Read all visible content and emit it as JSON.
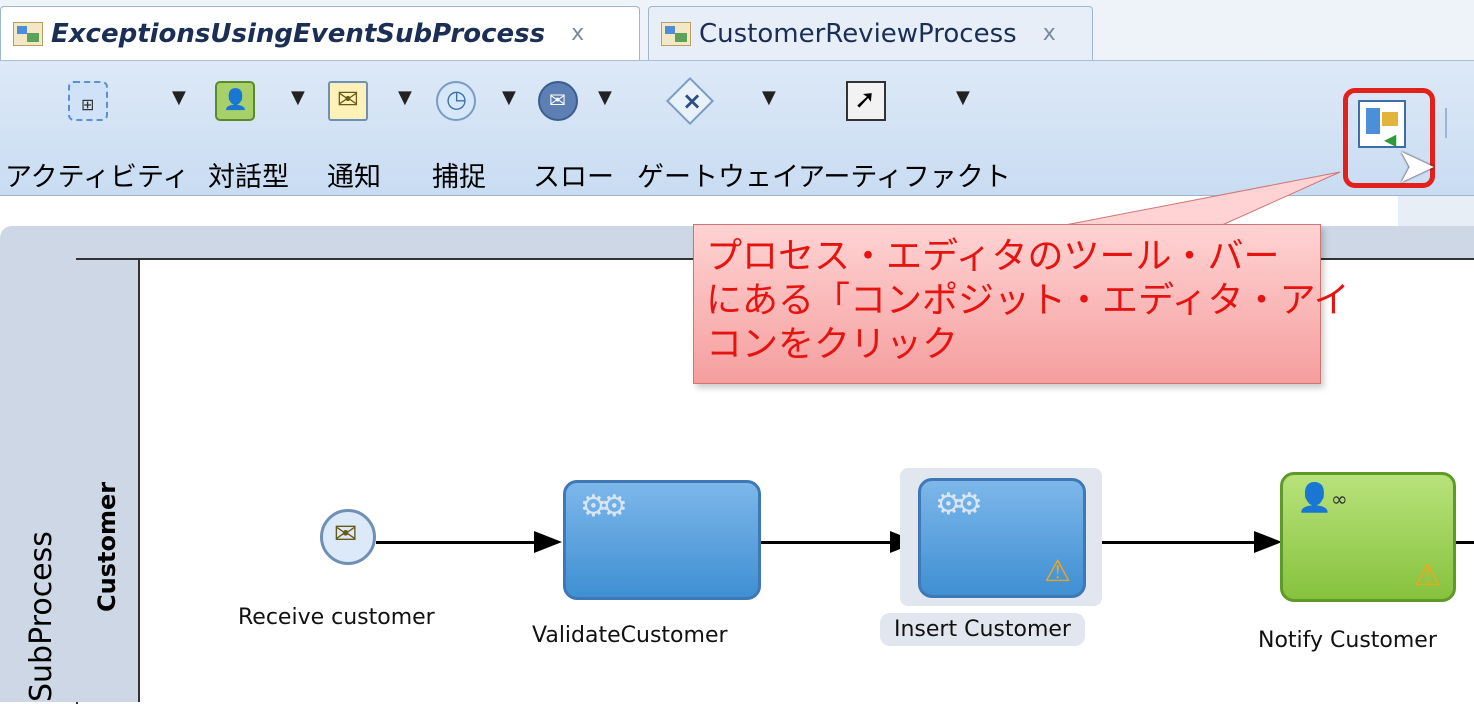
{
  "tabs": [
    {
      "label": "ExceptionsUsingEventSubProcess",
      "close": "x"
    },
    {
      "label": "CustomerReviewProcess",
      "close": "x"
    }
  ],
  "toolbar": {
    "items": [
      {
        "label": "アクティビティ",
        "icon": "activity-icon"
      },
      {
        "label": "対話型",
        "icon": "interactive-icon"
      },
      {
        "label": "通知",
        "icon": "notification-icon"
      },
      {
        "label": "捕捉",
        "icon": "catch-icon"
      },
      {
        "label": "スロー",
        "icon": "throw-icon"
      },
      {
        "label": "ゲートウェイ",
        "icon": "gateway-icon"
      },
      {
        "label": "アーティファクト",
        "icon": "artifact-icon"
      }
    ],
    "composite_editor_icon": "composite-editor-icon"
  },
  "callout": {
    "text_lines": [
      "プロセス・エディタのツール・バー",
      "にある「コンポジット・エディタ・アイ",
      "コンをクリック"
    ],
    "colors": {
      "text": "#e51410",
      "highlight_border": "#e2211c"
    }
  },
  "diagram": {
    "pool_label": "SubProcess",
    "lane_label": "Customer",
    "nodes": [
      {
        "label": "Receive customer",
        "type": "start-message-event"
      },
      {
        "label": "ValidateCustomer",
        "type": "service-task"
      },
      {
        "label": "Insert Customer",
        "type": "service-task",
        "warning": true,
        "selected": true
      },
      {
        "label": "Notify Customer",
        "type": "user-task",
        "warning": true
      }
    ]
  }
}
